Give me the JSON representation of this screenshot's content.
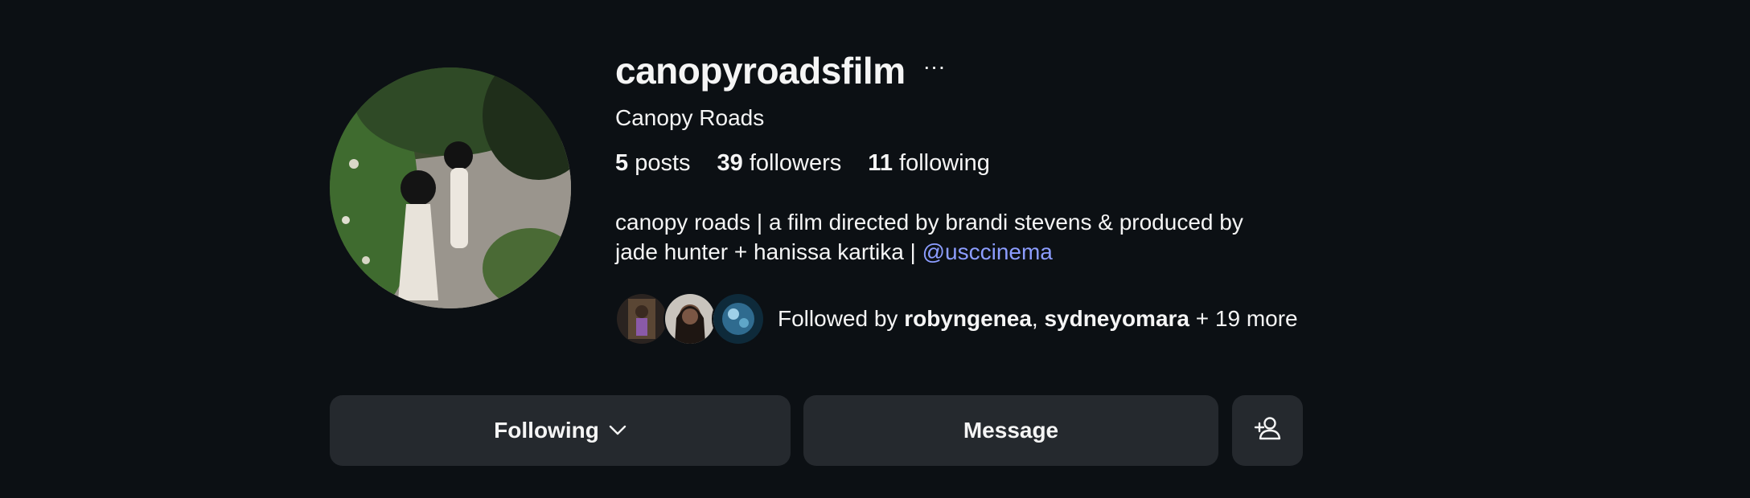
{
  "profile": {
    "username": "canopyroadsfilm",
    "more_icon": "···",
    "full_name": "Canopy Roads",
    "stats": {
      "posts_count": "5",
      "posts_label": "posts",
      "followers_count": "39",
      "followers_label": "followers",
      "following_count": "11",
      "following_label": "following"
    },
    "bio": {
      "line1": "canopy roads | a film directed by brandi stevens & produced by",
      "line2": "jade hunter + hanissa kartika | ",
      "mention": "@usccinema"
    },
    "followed_by": {
      "prefix": "Followed by ",
      "user1": "robyngenea",
      "separator": ", ",
      "user2": "sydneyomara",
      "suffix": " + 19 more"
    }
  },
  "actions": {
    "following_label": "Following",
    "message_label": "Message",
    "add_user_icon": "person-add-icon"
  },
  "colors": {
    "background": "#0c1014",
    "button_bg": "#25292e",
    "text": "#f5f5f5",
    "link": "#8c9dff"
  }
}
